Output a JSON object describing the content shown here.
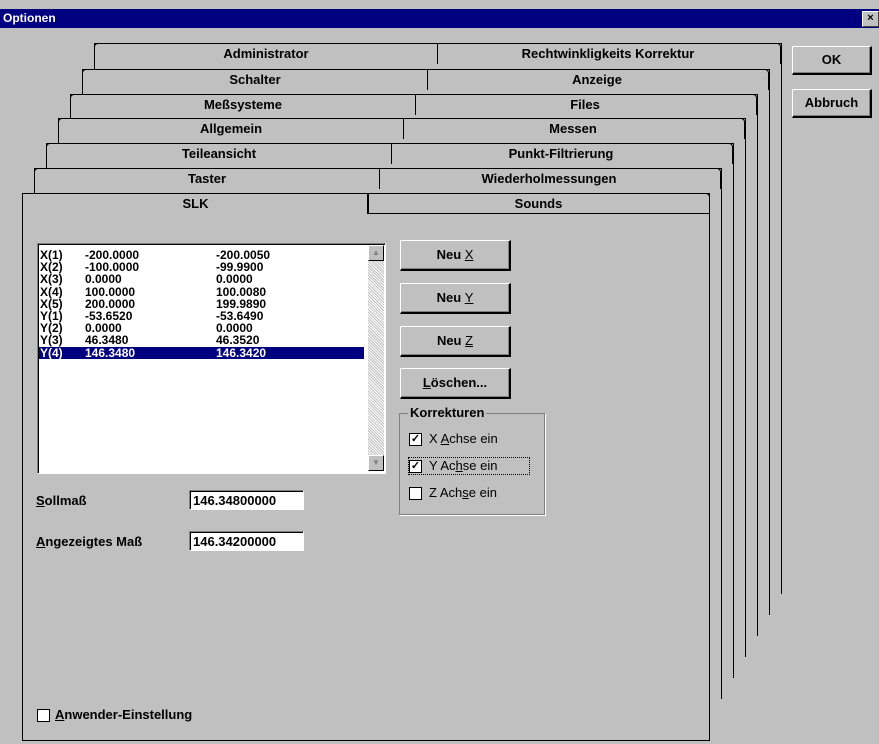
{
  "window": {
    "title": "Optionen",
    "close": "×"
  },
  "tabs": [
    {
      "left": "Administrator",
      "right": "Rechtwinkligkeits Korrektur"
    },
    {
      "left": "Schalter",
      "right": "Anzeige"
    },
    {
      "left": "Meßsysteme",
      "right": "Files"
    },
    {
      "left": "Allgemein",
      "right": "Messen"
    },
    {
      "left": "Teileansicht",
      "right": "Punkt-Filtrierung"
    },
    {
      "left": "Taster",
      "right": "Wiederholmessungen"
    },
    {
      "left": "SLK",
      "right": "Sounds"
    }
  ],
  "buttons": {
    "ok": "OK",
    "cancel": "Abbruch"
  },
  "list": {
    "rows": [
      {
        "id": "X(1)",
        "nominal": "-200.0000",
        "actual": "-200.0050"
      },
      {
        "id": "X(2)",
        "nominal": "-100.0000",
        "actual": "-99.9900"
      },
      {
        "id": "X(3)",
        "nominal": "0.0000",
        "actual": "0.0000"
      },
      {
        "id": "X(4)",
        "nominal": "100.0000",
        "actual": "100.0080"
      },
      {
        "id": "X(5)",
        "nominal": "200.0000",
        "actual": "199.9890"
      },
      {
        "id": "Y(1)",
        "nominal": "-53.6520",
        "actual": "-53.6490"
      },
      {
        "id": "Y(2)",
        "nominal": "0.0000",
        "actual": "0.0000"
      },
      {
        "id": "Y(3)",
        "nominal": "46.3480",
        "actual": "46.3520"
      },
      {
        "id": "Y(4)",
        "nominal": "146.3480",
        "actual": "146.3420"
      }
    ],
    "selected_index": 8
  },
  "actions": {
    "new_x": {
      "text": "Neu ",
      "key": "X"
    },
    "new_y": {
      "text": "Neu ",
      "key": "Y"
    },
    "new_z": {
      "text": "Neu ",
      "key": "Z"
    },
    "delete": {
      "key": "L",
      "text": "öschen..."
    }
  },
  "korrekturen": {
    "title": "Korrekturen",
    "x": {
      "pre": "X ",
      "key": "A",
      "post": "chse ein",
      "checked": true
    },
    "y": {
      "pre": "Y Ac",
      "key": "h",
      "post": "se ein",
      "checked": true
    },
    "z": {
      "pre": "Z Ach",
      "key": "s",
      "post": "e ein",
      "checked": false
    }
  },
  "fields": {
    "sollmass": {
      "key": "S",
      "label": "ollmaß",
      "value": "146.34800000"
    },
    "angezeigt": {
      "key": "A",
      "label": "ngezeigtes Maß",
      "value": "146.34200000"
    }
  },
  "anwender": {
    "key": "A",
    "label": "nwender-Einstellung",
    "checked": false
  },
  "check_glyph": "✓"
}
